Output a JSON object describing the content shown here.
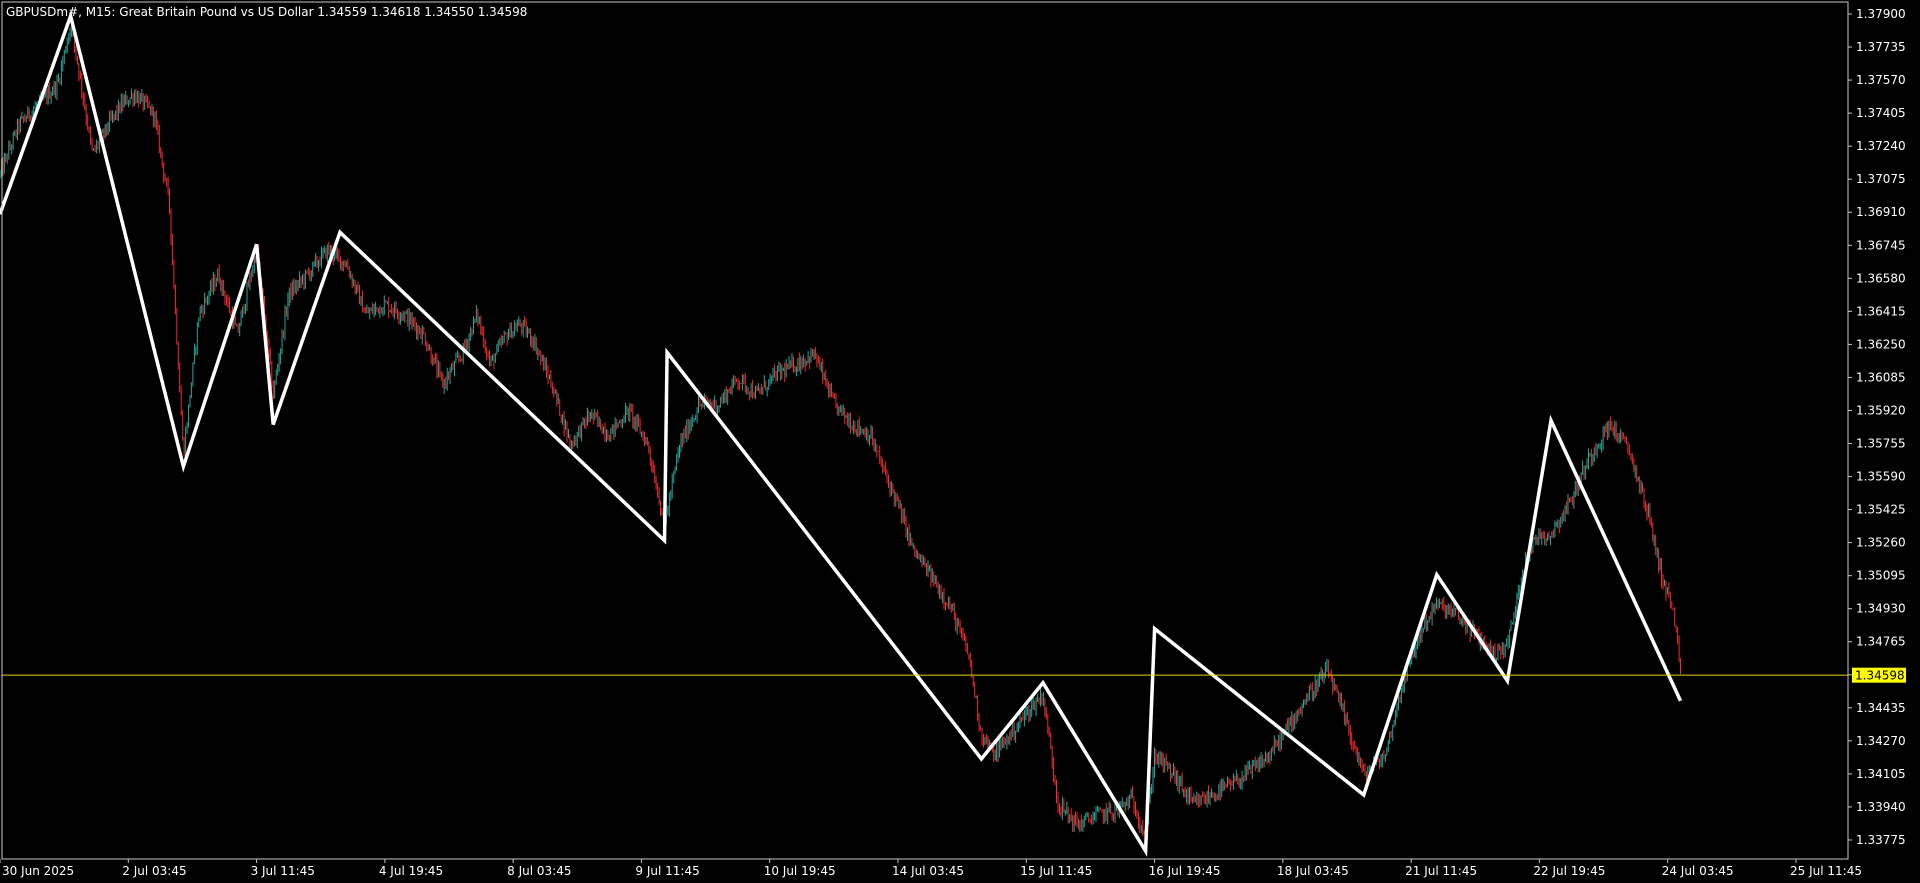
{
  "header": {
    "symbol": "GBPUSDm#",
    "timeframe": "M15:",
    "description": "Great Britain Pound vs US Dollar",
    "open": "1.34559",
    "high": "1.34618",
    "low": "1.34550",
    "close": "1.34598"
  },
  "colors": {
    "background": "#000000",
    "frame": "#c8c8c8",
    "bull": "#26a69a",
    "bear": "#ef2d2d",
    "zigzag": "#ffffff",
    "bid_line": "#e6d200",
    "bid_label_bg": "#ffff00"
  },
  "chart_data": {
    "type": "line",
    "y_ticks": [
      "1.37900",
      "1.37735",
      "1.37570",
      "1.37405",
      "1.37240",
      "1.37075",
      "1.36910",
      "1.36745",
      "1.36580",
      "1.36415",
      "1.36250",
      "1.36085",
      "1.35920",
      "1.35755",
      "1.35590",
      "1.35425",
      "1.35260",
      "1.35095",
      "1.34930",
      "1.34765",
      "1.34600",
      "1.34435",
      "1.34270",
      "1.34105",
      "1.33940",
      "1.33775"
    ],
    "x_ticks": [
      "30 Jun 2025",
      "2 Jul 03:45",
      "3 Jul 11:45",
      "4 Jul 19:45",
      "8 Jul 03:45",
      "9 Jul 11:45",
      "10 Jul 19:45",
      "14 Jul 03:45",
      "15 Jul 11:45",
      "16 Jul 19:45",
      "18 Jul 03:45",
      "21 Jul 11:45",
      "22 Jul 19:45",
      "24 Jul 03:45",
      "25 Jul 11:45"
    ],
    "ylim": [
      1.3368,
      1.3796
    ],
    "current_price": 1.34598,
    "current_price_label": "1.34598",
    "series": [
      {
        "type": "zigzag",
        "points": [
          [
            0,
            1.369
          ],
          [
            0.55,
            1.3789
          ],
          [
            1.43,
            1.3564
          ],
          [
            2.0,
            1.3675
          ],
          [
            2.13,
            1.3585
          ],
          [
            2.65,
            1.3681
          ],
          [
            5.18,
            1.3527
          ],
          [
            5.2,
            1.3621
          ],
          [
            7.65,
            1.3418
          ],
          [
            8.13,
            1.3456
          ],
          [
            8.93,
            1.3372
          ],
          [
            9.0,
            1.3483
          ],
          [
            10.63,
            1.34
          ],
          [
            11.2,
            1.351
          ],
          [
            11.75,
            1.3457
          ],
          [
            12.09,
            1.3587
          ],
          [
            13.1,
            1.3447
          ]
        ]
      },
      {
        "type": "price_path",
        "points": [
          [
            0,
            1.371
          ],
          [
            0.15,
            1.3735
          ],
          [
            0.3,
            1.3745
          ],
          [
            0.45,
            1.3755
          ],
          [
            0.55,
            1.3785
          ],
          [
            0.62,
            1.376
          ],
          [
            0.72,
            1.372
          ],
          [
            0.85,
            1.3735
          ],
          [
            0.95,
            1.3745
          ],
          [
            1.05,
            1.375
          ],
          [
            1.2,
            1.374
          ],
          [
            1.32,
            1.3695
          ],
          [
            1.43,
            1.357
          ],
          [
            1.55,
            1.364
          ],
          [
            1.7,
            1.366
          ],
          [
            1.85,
            1.363
          ],
          [
            2.0,
            1.3672
          ],
          [
            2.13,
            1.36
          ],
          [
            2.25,
            1.365
          ],
          [
            2.4,
            1.366
          ],
          [
            2.55,
            1.3672
          ],
          [
            2.7,
            1.3665
          ],
          [
            2.85,
            1.364
          ],
          [
            3.0,
            1.3645
          ],
          [
            3.15,
            1.364
          ],
          [
            3.3,
            1.363
          ],
          [
            3.45,
            1.3605
          ],
          [
            3.6,
            1.362
          ],
          [
            3.72,
            1.364
          ],
          [
            3.82,
            1.3615
          ],
          [
            3.95,
            1.363
          ],
          [
            4.05,
            1.3635
          ],
          [
            4.15,
            1.3628
          ],
          [
            4.3,
            1.3605
          ],
          [
            4.45,
            1.3575
          ],
          [
            4.6,
            1.359
          ],
          [
            4.75,
            1.358
          ],
          [
            4.9,
            1.3592
          ],
          [
            5.05,
            1.3575
          ],
          [
            5.18,
            1.3535
          ],
          [
            5.3,
            1.3575
          ],
          [
            5.45,
            1.3595
          ],
          [
            5.6,
            1.3595
          ],
          [
            5.75,
            1.3608
          ],
          [
            5.9,
            1.36
          ],
          [
            6.05,
            1.361
          ],
          [
            6.2,
            1.3615
          ],
          [
            6.35,
            1.362
          ],
          [
            6.5,
            1.3595
          ],
          [
            6.65,
            1.3585
          ],
          [
            6.78,
            1.358
          ],
          [
            6.9,
            1.356
          ],
          [
            7.0,
            1.3545
          ],
          [
            7.12,
            1.3522
          ],
          [
            7.25,
            1.351
          ],
          [
            7.4,
            1.3495
          ],
          [
            7.55,
            1.347
          ],
          [
            7.65,
            1.343
          ],
          [
            7.75,
            1.342
          ],
          [
            7.9,
            1.3432
          ],
          [
            8.05,
            1.3445
          ],
          [
            8.13,
            1.345
          ],
          [
            8.25,
            1.3395
          ],
          [
            8.4,
            1.3385
          ],
          [
            8.55,
            1.339
          ],
          [
            8.7,
            1.3392
          ],
          [
            8.82,
            1.3398
          ],
          [
            8.93,
            1.338
          ],
          [
            9.0,
            1.342
          ],
          [
            9.15,
            1.341
          ],
          [
            9.3,
            1.3395
          ],
          [
            9.45,
            1.34
          ],
          [
            9.6,
            1.3405
          ],
          [
            9.75,
            1.3412
          ],
          [
            9.9,
            1.342
          ],
          [
            10.05,
            1.3435
          ],
          [
            10.2,
            1.345
          ],
          [
            10.35,
            1.3462
          ],
          [
            10.5,
            1.3435
          ],
          [
            10.63,
            1.341
          ],
          [
            10.8,
            1.342
          ],
          [
            10.95,
            1.346
          ],
          [
            11.1,
            1.3485
          ],
          [
            11.2,
            1.3495
          ],
          [
            11.35,
            1.349
          ],
          [
            11.5,
            1.348
          ],
          [
            11.65,
            1.347
          ],
          [
            11.75,
            1.3475
          ],
          [
            11.9,
            1.352
          ],
          [
            12.0,
            1.353
          ],
          [
            12.09,
            1.353
          ],
          [
            12.25,
            1.3548
          ],
          [
            12.4,
            1.357
          ],
          [
            12.55,
            1.3585
          ],
          [
            12.7,
            1.3572
          ],
          [
            12.85,
            1.354
          ],
          [
            12.95,
            1.351
          ],
          [
            13.05,
            1.349
          ],
          [
            13.1,
            1.346
          ]
        ]
      }
    ]
  }
}
